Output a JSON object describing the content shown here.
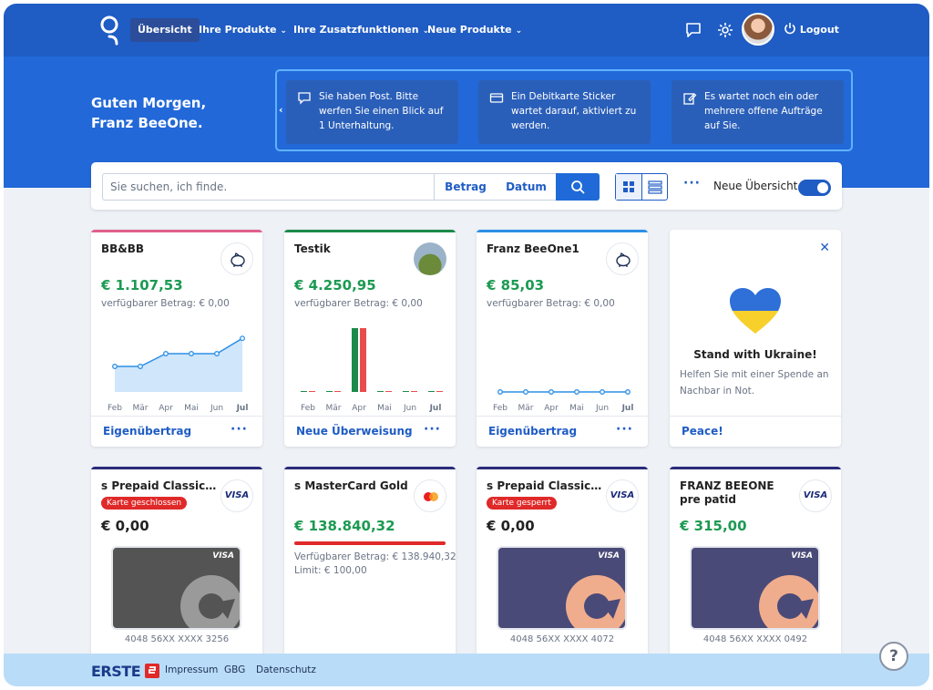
{
  "nav": {
    "items": [
      {
        "label": "Übersicht",
        "active": true
      },
      {
        "label": "Ihre Produkte"
      },
      {
        "label": "Ihre Zusatzfunktionen"
      },
      {
        "label": "Neue Produkte"
      }
    ],
    "logout": "Logout",
    "icons": [
      "logo-icon",
      "chat-icon",
      "gear-icon",
      "power-icon",
      "chevron-down-icon"
    ]
  },
  "hero": {
    "greeting_line1": "Guten Morgen,",
    "greeting_line2": "Franz BeeOne.",
    "notifications": [
      {
        "icon": "chat-icon",
        "text": "Sie haben Post. Bitte werfen Sie einen Blick auf 1 Unterhaltung."
      },
      {
        "icon": "card-icon",
        "text": "Ein Debitkarte Sticker wartet darauf, aktiviert zu werden."
      },
      {
        "icon": "edit-icon",
        "text": "Es wartet noch ein oder mehrere offene Aufträge auf Sie."
      }
    ]
  },
  "search": {
    "placeholder": "Sie suchen, ich finde.",
    "filter_amount": "Betrag",
    "filter_date": "Datum",
    "toggle_label": "Neue Übersicht",
    "toggle_on": true
  },
  "accounts": [
    {
      "title": "BB&BB",
      "amount": "€ 1.107,53",
      "available": "verfügbarer Betrag: € 0,00",
      "action": "Eigenübertrag",
      "color": "#e0608c",
      "chart": {
        "type": "area",
        "months": [
          "Feb",
          "Mär",
          "Apr",
          "Mai",
          "Jun",
          "Jul"
        ],
        "values": [
          2,
          2,
          3,
          3,
          3,
          4.2
        ],
        "ylim": [
          0,
          5
        ]
      }
    },
    {
      "title": "Testik",
      "amount": "€ 4.250,95",
      "available": "verfügbarer Betrag: € 0,00",
      "action": "Neue Überweisung",
      "color": "#1c8a4a",
      "chart": {
        "type": "bar",
        "months": [
          "Feb",
          "Mär",
          "Apr",
          "Mai",
          "Jun",
          "Jul"
        ],
        "income": [
          0,
          0,
          10,
          0,
          0,
          0
        ],
        "expense": [
          0,
          0,
          10,
          0,
          0,
          0
        ],
        "ylim": [
          0,
          10
        ]
      }
    },
    {
      "title": "Franz BeeOne1",
      "amount": "€ 85,03",
      "available": "verfügbarer Betrag: € 0,00",
      "action": "Eigenübertrag",
      "color": "#2d8fe6",
      "chart": {
        "type": "line",
        "months": [
          "Feb",
          "Mär",
          "Apr",
          "Mai",
          "Jun",
          "Jul"
        ],
        "values": [
          0,
          0,
          0,
          0,
          0,
          0
        ],
        "ylim": [
          0,
          5
        ]
      }
    }
  ],
  "ukraine": {
    "title": "Stand with Ukraine!",
    "text": "Helfen Sie mit einer Spende an Nachbar in Not.",
    "action": "Peace!"
  },
  "cards": [
    {
      "title": "s Prepaid Classic | C...",
      "badge": "Karte geschlossen",
      "amount": "€ 0,00",
      "number": "4048 56XX XXXX 3256",
      "brand": "VISA",
      "style": "grey"
    },
    {
      "title": "s MasterCard Gold",
      "amount": "€ 138.840,32",
      "available": "Verfügbarer Betrag: € 138.940,32",
      "limit": "Limit: € 100,00",
      "usage": 1.0,
      "brand": "mastercard"
    },
    {
      "title": "s Prepaid Classic | C...",
      "badge": "Karte gesperrt",
      "amount": "€ 0,00",
      "number": "4048 56XX XXXX 4072",
      "brand": "VISA",
      "style": "purple"
    },
    {
      "title": "FRANZ BEEONE pre patid",
      "amount": "€ 315,00",
      "number": "4048 56XX XXXX 0492",
      "brand": "VISA",
      "style": "purple"
    }
  ],
  "footer": {
    "brand": "ERSTE",
    "links": [
      "Impressum",
      "GBG",
      "Datenschutz"
    ],
    "help": "?"
  },
  "colors": {
    "primary": "#1f5cc4",
    "hero": "#2268d8",
    "green": "#1c9a52",
    "red": "#e02929"
  }
}
